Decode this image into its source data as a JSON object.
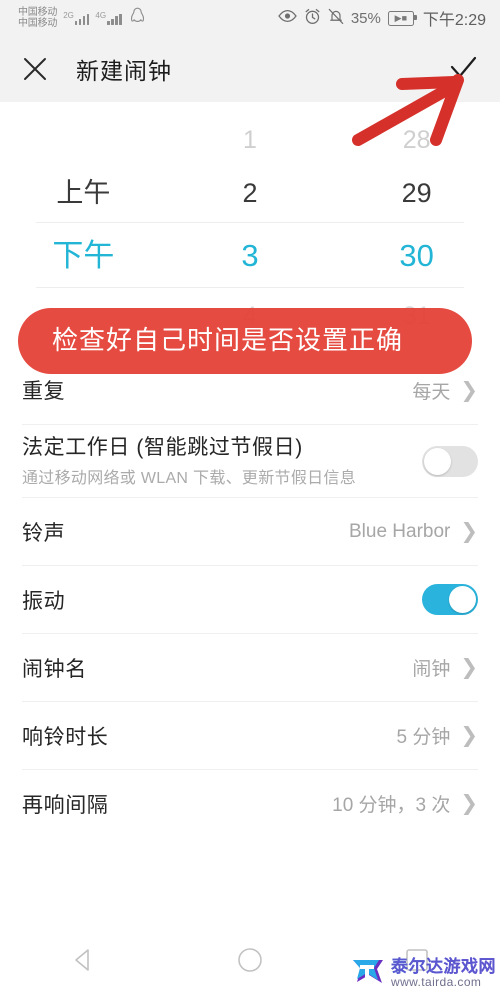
{
  "statusbar": {
    "carrier_line1": "中国移动",
    "carrier_line2": "中国移动",
    "net1": "2G",
    "net2": "4G",
    "qq_icon": "qq-penguin-icon",
    "eye_icon": "eye-icon",
    "alarm_icon": "alarm-clock-icon",
    "mute_icon": "bell-muted-icon",
    "battery_percent": "35%",
    "battery_icon": "battery-charging-icon",
    "time": "下午2:29"
  },
  "appbar": {
    "close_icon": "close-icon",
    "title": "新建闹钟",
    "confirm_icon": "check-icon"
  },
  "picker": {
    "columns": [
      "meridiem",
      "hour",
      "minute"
    ],
    "rows": [
      {
        "state": "dim",
        "meridiem": "",
        "hour": "1",
        "minute": "28"
      },
      {
        "state": "near",
        "meridiem": "上午",
        "hour": "2",
        "minute": "29"
      },
      {
        "state": "sel",
        "meridiem": "下午",
        "hour": "3",
        "minute": "30"
      },
      {
        "state": "dim2",
        "meridiem": "",
        "hour": "4",
        "minute": "31"
      }
    ],
    "selected_time": "下午 3:30",
    "selected_color": "#22b5d6"
  },
  "annotations": {
    "banner_text": "检查好自己时间是否设置正确",
    "banner_color": "#e44035",
    "arrow_color": "#d6302a",
    "arrow_name": "red-arrow-pointing-to-confirm"
  },
  "settings": [
    {
      "name": "repeat",
      "label": "重复",
      "value": "每天",
      "control": "chevron"
    },
    {
      "name": "workday",
      "label": "法定工作日 (智能跳过节假日)",
      "sub": "通过移动网络或 WLAN 下载、更新节假日信息",
      "control": "toggle",
      "toggle_on": false
    },
    {
      "name": "ringtone",
      "label": "铃声",
      "value": "Blue Harbor",
      "control": "chevron"
    },
    {
      "name": "vibrate",
      "label": "振动",
      "control": "toggle",
      "toggle_on": true
    },
    {
      "name": "alarm-name",
      "label": "闹钟名",
      "value": "闹钟",
      "control": "chevron"
    },
    {
      "name": "ring-duration",
      "label": "响铃时长",
      "value": "5 分钟",
      "control": "chevron"
    },
    {
      "name": "snooze-interval",
      "label": "再响间隔",
      "value": "10 分钟，3 次",
      "control": "chevron"
    }
  ],
  "navbar": {
    "back_icon": "back-triangle-icon",
    "home_icon": "home-circle-icon",
    "recents_icon": "recents-square-icon"
  },
  "watermark": {
    "logo_letter": "T",
    "site_name": "泰尔达游戏网",
    "site_url": "www.tairda.com"
  }
}
